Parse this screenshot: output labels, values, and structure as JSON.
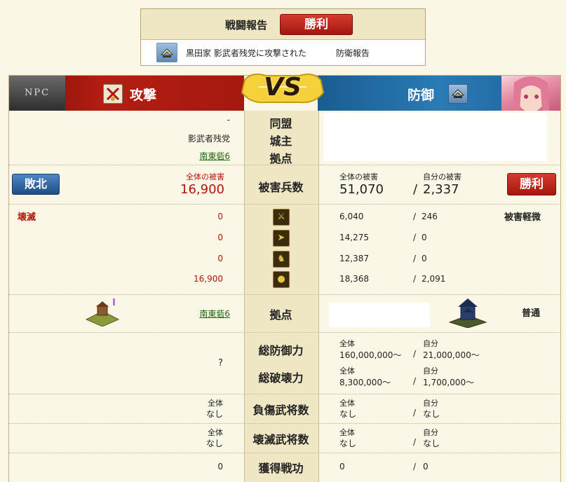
{
  "header": {
    "title": "戦闘報告",
    "result": "勝利",
    "subtitle": "黒田家 影武者残党に攻撃された",
    "subtitle_suffix": "防衛報告"
  },
  "band": {
    "npc_label": "NPC",
    "attack_label": "攻撃",
    "vs_label": "VS",
    "defense_label": "防御"
  },
  "info": {
    "attacker_alliance": "-",
    "attacker_lord": "影武者残党",
    "attacker_base": "南東砦6",
    "labels": {
      "alliance": "同盟",
      "lord": "城主",
      "base": "拠点"
    }
  },
  "damage": {
    "label": "被害兵数",
    "attacker_result": "敗北",
    "attacker_total_label": "全体の被害",
    "attacker_total": "16,900",
    "defender_total_label": "全体の被害",
    "defender_total": "51,070",
    "defender_self_label": "自分の被害",
    "defender_self": "2,337",
    "defender_result": "勝利"
  },
  "units": {
    "attacker_status": "壊滅",
    "defender_status": "被害軽微",
    "rows": [
      {
        "icon": "spear-icon",
        "attacker": "0",
        "def_total": "6,040",
        "def_self": "246"
      },
      {
        "icon": "bow-icon",
        "attacker": "0",
        "def_total": "14,275",
        "def_self": "0"
      },
      {
        "icon": "horse-icon",
        "attacker": "0",
        "def_total": "12,387",
        "def_self": "0"
      },
      {
        "icon": "cannon-icon",
        "attacker": "16,900",
        "def_total": "18,368",
        "def_self": "2,091"
      }
    ]
  },
  "base": {
    "label": "拠点",
    "attacker_base": "南東砦6",
    "defender_status": "普通"
  },
  "power": {
    "defense_label": "総防御力",
    "destroy_label": "総破壊力",
    "attacker_value": "?",
    "total_label": "全体",
    "self_label": "自分",
    "defense_total": "160,000,000～",
    "defense_self": "21,000,000～",
    "destroy_total": "8,300,000～",
    "destroy_self": "1,700,000～"
  },
  "injured": {
    "label": "負傷武将数",
    "total_label": "全体",
    "self_label": "自分",
    "attacker": "なし",
    "def_total": "なし",
    "def_self": "なし"
  },
  "destroyed": {
    "label": "壊滅武将数",
    "total_label": "全体",
    "self_label": "自分",
    "attacker": "なし",
    "def_total": "なし",
    "def_self": "なし"
  },
  "merit": {
    "label": "獲得戦功",
    "attacker": "0",
    "def_total": "0",
    "def_self": "0"
  },
  "sep": "/",
  "colors": {
    "red": "#b5140a",
    "blue": "#2a7bb5",
    "link": "#1f6a12"
  }
}
